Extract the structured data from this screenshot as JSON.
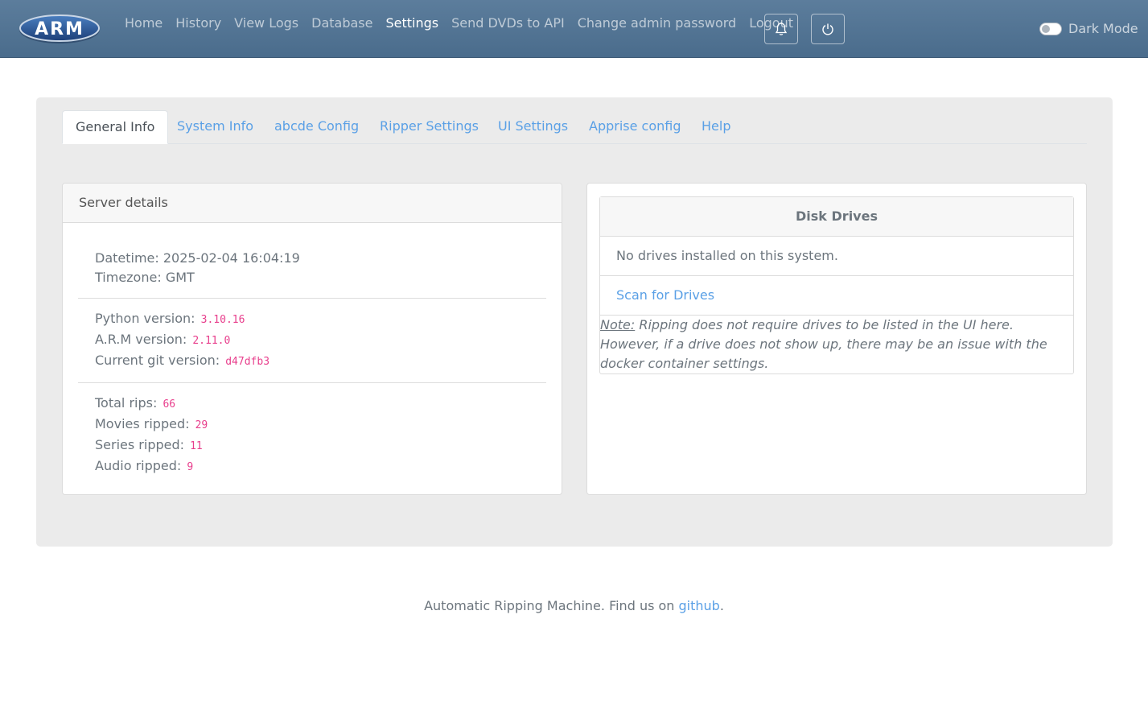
{
  "navbar": {
    "logo_text": "ARM",
    "links": [
      {
        "label": "Home",
        "active": false
      },
      {
        "label": "History",
        "active": false
      },
      {
        "label": "View Logs",
        "active": false
      },
      {
        "label": "Database",
        "active": false
      },
      {
        "label": "Settings",
        "active": true
      },
      {
        "label": "Send DVDs to API",
        "active": false
      },
      {
        "label": "Change admin password",
        "active": false
      },
      {
        "label": "Logout",
        "active": false
      }
    ],
    "notification_icon": "bell-icon",
    "power_icon": "power-icon",
    "dark_mode_label": "Dark Mode",
    "dark_mode_enabled": false
  },
  "tabs": [
    {
      "label": "General Info",
      "active": true
    },
    {
      "label": "System Info",
      "active": false
    },
    {
      "label": "abcde Config",
      "active": false
    },
    {
      "label": "Ripper Settings",
      "active": false
    },
    {
      "label": "UI Settings",
      "active": false
    },
    {
      "label": "Apprise config",
      "active": false
    },
    {
      "label": "Help",
      "active": false
    }
  ],
  "server": {
    "title": "Server details",
    "datetime_label": "Datetime:",
    "datetime": "2025-02-04 16:04:19",
    "timezone_label": "Timezone:",
    "timezone": "GMT",
    "python_label": "Python version:",
    "python_version": "3.10.16",
    "arm_label": "A.R.M version:",
    "arm_version": "2.11.0",
    "git_label": "Current git version:",
    "git_version": "d47dfb3",
    "total_label": "Total rips:",
    "total_rips": "66",
    "movies_label": "Movies ripped:",
    "movies_ripped": "29",
    "series_label": "Series ripped:",
    "series_ripped": "11",
    "audio_label": "Audio ripped:",
    "audio_ripped": "9"
  },
  "drives": {
    "title": "Disk Drives",
    "empty_text": "No drives installed on this system.",
    "scan_label": "Scan for Drives",
    "note_label": "Note:",
    "note_text": " Ripping does not require drives to be listed in the UI here. However, if a drive does not show up, there may be an issue with the docker container settings."
  },
  "footer": {
    "text": "Automatic Ripping Machine. Find us on ",
    "link_label": "github",
    "suffix": "."
  },
  "colors": {
    "navbar": "#4f7192",
    "link": "#5aa0e6",
    "code": "#e83e8c",
    "jumbotron": "#ebebeb"
  }
}
